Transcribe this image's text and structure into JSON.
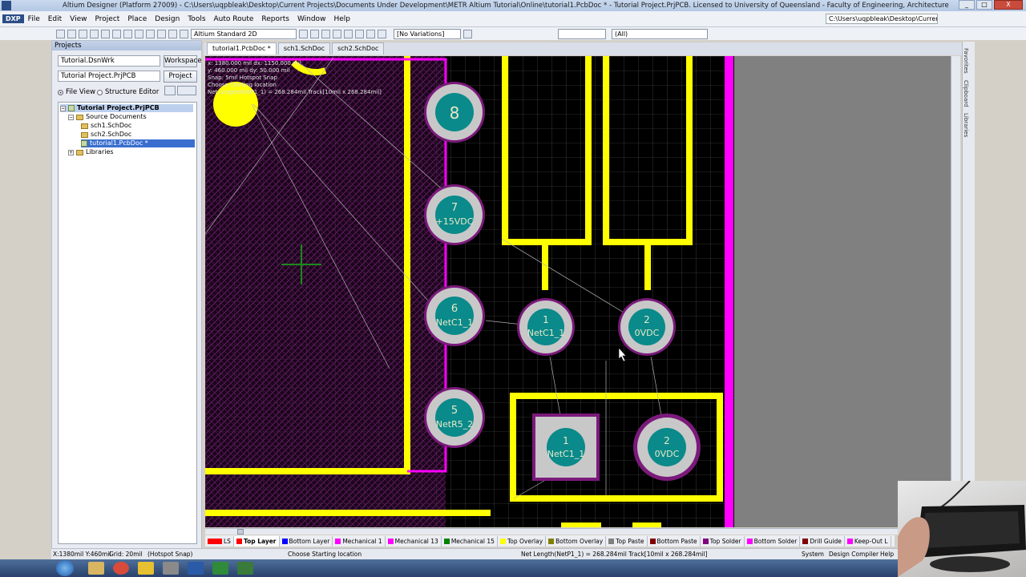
{
  "window": {
    "title": "Altium Designer (Platform 27009) - C:\\Users\\uqpbleak\\Desktop\\Current Projects\\Documents Under Development\\METR Altium Tutorial\\Online\\tutorial1.PcbDoc * - Tutorial Project.PrjPCB. Licensed to University of Queensland - Faculty of Engineering, Architecture",
    "min_label": "_",
    "max_label": "□",
    "close_label": "X"
  },
  "menu": {
    "dxp": "DXP",
    "items": [
      "File",
      "Edit",
      "View",
      "Project",
      "Place",
      "Design",
      "Tools",
      "Auto Route",
      "Reports",
      "Window",
      "Help"
    ],
    "path": "C:\\Users\\uqpbleak\\Desktop\\Curren"
  },
  "toolbar": {
    "view_combo": "Altium Standard 2D",
    "variation_combo": "[No Variations]",
    "filter_combo": "(All)"
  },
  "projects_panel": {
    "title": "Projects",
    "workspace_field": "Tutorial.DsnWrk",
    "workspace_button": "Workspace",
    "project_field": "Tutorial Project.PrjPCB",
    "project_button": "Project",
    "file_view": "File View",
    "structure_editor": "Structure Editor",
    "tree": {
      "project": "Tutorial Project.PrjPCB",
      "source_documents": "Source Documents",
      "sch1": "sch1.SchDoc",
      "sch2": "sch2.SchDoc",
      "pcb": "tutorial1.PcbDoc *",
      "libraries": "Libraries"
    }
  },
  "doc_tabs": [
    "tutorial1.PcbDoc *",
    "sch1.SchDoc",
    "sch2.SchDoc"
  ],
  "canvas": {
    "hud": {
      "x": "x:  1380.000 mil   dx:  1150.000 mil",
      "y": "y:   460.000  mil   dy:    50.000  mil",
      "snap": "Snap: 5mil Hotspot Snap",
      "prompt": "Choose Starting location",
      "net": "Net Length(NetP1_1) = 268.284mil  Track[10mil x 268.284mil]"
    },
    "pads": [
      {
        "num": "8",
        "net": ""
      },
      {
        "num": "7",
        "net": "+15VDC"
      },
      {
        "num": "6",
        "net": "NetC1_1"
      },
      {
        "num": "5",
        "net": "NetR5_2"
      },
      {
        "num": "1",
        "net": "NetC1_1"
      },
      {
        "num": "2",
        "net": "0VDC"
      },
      {
        "num": "1",
        "net": "NetC1_1"
      },
      {
        "num": "2",
        "net": "0VDC"
      }
    ]
  },
  "right_strip": [
    "Favorites",
    "Clipboard",
    "Libraries"
  ],
  "layers": [
    {
      "name": "LS",
      "color": "#ff0000"
    },
    {
      "name": "Top Layer",
      "color": "#ff0000"
    },
    {
      "name": "Bottom Layer",
      "color": "#0000ff"
    },
    {
      "name": "Mechanical 1",
      "color": "#ff00ff"
    },
    {
      "name": "Mechanical 13",
      "color": "#ff00ff"
    },
    {
      "name": "Mechanical 15",
      "color": "#008000"
    },
    {
      "name": "Top Overlay",
      "color": "#ffff00"
    },
    {
      "name": "Bottom Overlay",
      "color": "#808000"
    },
    {
      "name": "Top Paste",
      "color": "#808080"
    },
    {
      "name": "Bottom Paste",
      "color": "#800000"
    },
    {
      "name": "Top Solder",
      "color": "#800080"
    },
    {
      "name": "Bottom Solder",
      "color": "#ff00ff"
    },
    {
      "name": "Drill Guide",
      "color": "#800000"
    },
    {
      "name": "Keep-Out L",
      "color": "#ff00ff"
    }
  ],
  "status": {
    "coords": "X:1380mil Y:460mil",
    "grid": "Grid: 20mil",
    "snap": "(Hotspot Snap)",
    "prompt": "Choose Starting location",
    "net": "Net Length(NetP1_1) = 268.284mil  Track[10mil x 268.284mil]",
    "system": "System",
    "design_compiler": "Design Compiler",
    "help": "Help"
  }
}
